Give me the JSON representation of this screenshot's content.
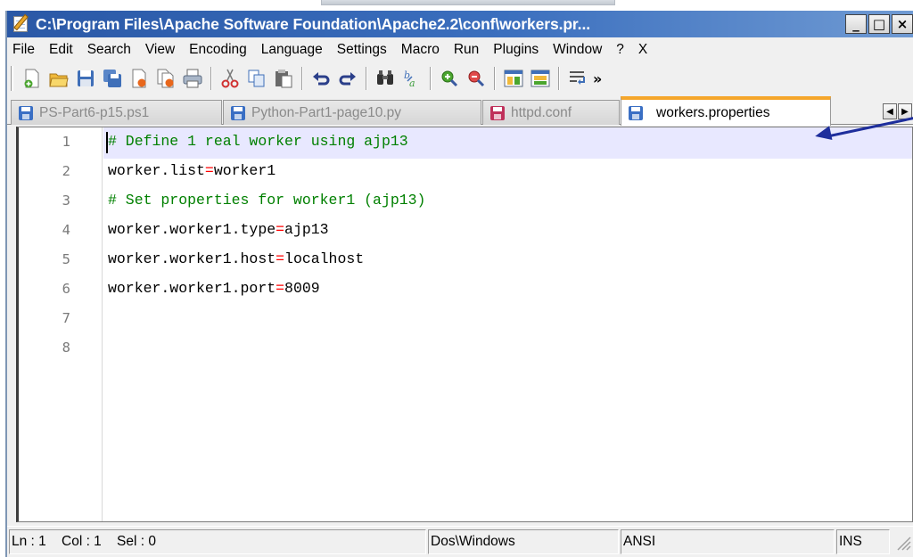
{
  "title": "C:\\Program Files\\Apache Software Foundation\\Apache2.2\\conf\\workers.pr...",
  "window_buttons": {
    "minimize": "_",
    "maximize": "□",
    "close": "×"
  },
  "menu": [
    "File",
    "Edit",
    "Search",
    "View",
    "Encoding",
    "Language",
    "Settings",
    "Macro",
    "Run",
    "Plugins",
    "Window",
    "?",
    "X"
  ],
  "toolbar": {
    "icons": [
      "new-file",
      "open-folder",
      "save",
      "save-all",
      "close",
      "close-all",
      "print",
      "cut",
      "copy",
      "paste",
      "undo",
      "redo",
      "find",
      "replace",
      "zoom-in",
      "zoom-out",
      "sync-vertical",
      "sync-horizontal",
      "word-wrap"
    ],
    "more": "»"
  },
  "tabs": [
    {
      "label": "PS-Part6-p15.ps1",
      "icon_color": "#3a6fc4"
    },
    {
      "label": "Python-Part1-page10.py",
      "icon_color": "#3a6fc4"
    },
    {
      "label": "httpd.conf",
      "icon_color": "#c0305a"
    },
    {
      "label": "workers.properties",
      "icon_color": "#3a6fc4",
      "active": true
    }
  ],
  "tab_scroll": {
    "left": "◀",
    "right": "▶"
  },
  "editor": {
    "lines": [
      {
        "num": "1",
        "text": "# Define 1 real worker using ajp13"
      },
      {
        "num": "2",
        "key": "worker.list",
        "op": "=",
        "value": "worker1"
      },
      {
        "num": "3",
        "text": "# Set properties for worker1 (ajp13)"
      },
      {
        "num": "4",
        "key": "worker.worker1.type",
        "op": "=",
        "value": "ajp13"
      },
      {
        "num": "5",
        "key": "worker.worker1.host",
        "op": "=",
        "value": "localhost"
      },
      {
        "num": "6",
        "key": "worker.worker1.port",
        "op": "=",
        "value": "8009"
      },
      {
        "num": "7"
      },
      {
        "num": "8"
      }
    ]
  },
  "status": {
    "position": "Ln : 1    Col : 1    Sel : 0",
    "eol": "Dos\\Windows",
    "encoding": "ANSI",
    "mode": "INS"
  },
  "colors": {
    "comment": "#008000",
    "operator": "#ff0000",
    "active_tab_accent": "#f5a62b",
    "current_line": "#e8e8ff",
    "annotation_arrow": "#1e2e9c"
  }
}
